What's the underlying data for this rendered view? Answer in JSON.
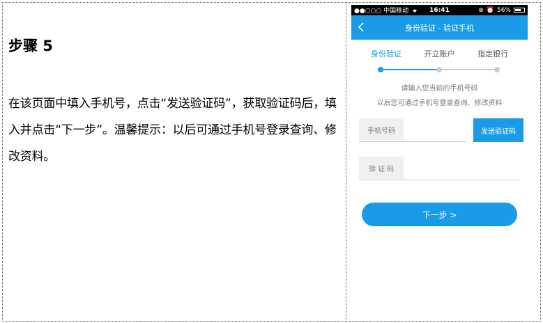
{
  "left": {
    "step_title": "步骤 5",
    "body": "在该页面中填入手机号，点击“发送验证码”，获取验证码后，填入并点击“下一步”。温馨提示：以后可通过手机号登录查询、修改资料。"
  },
  "phone": {
    "statusbar": {
      "carrier": "●●○○○ 中国移动",
      "time": "16:41",
      "battery": "56%"
    },
    "navbar": {
      "title": "身份验证 - 验证手机"
    },
    "tabs": [
      {
        "label": "身份验证",
        "active": true
      },
      {
        "label": "开立账户",
        "active": false
      },
      {
        "label": "指定银行",
        "active": false
      }
    ],
    "hint": {
      "line1": "请输入您当前的手机号码",
      "line2": "以后您可通过手机号登录查询、修改资料"
    },
    "phone_field": {
      "label": "手机号码"
    },
    "send_button": {
      "label": "发送验证码"
    },
    "code_field": {
      "label": "验 证 码"
    },
    "next_button": {
      "label": "下一步 >"
    },
    "colors": {
      "accent": "#1a9be8",
      "inactive": "#cccccc"
    }
  }
}
